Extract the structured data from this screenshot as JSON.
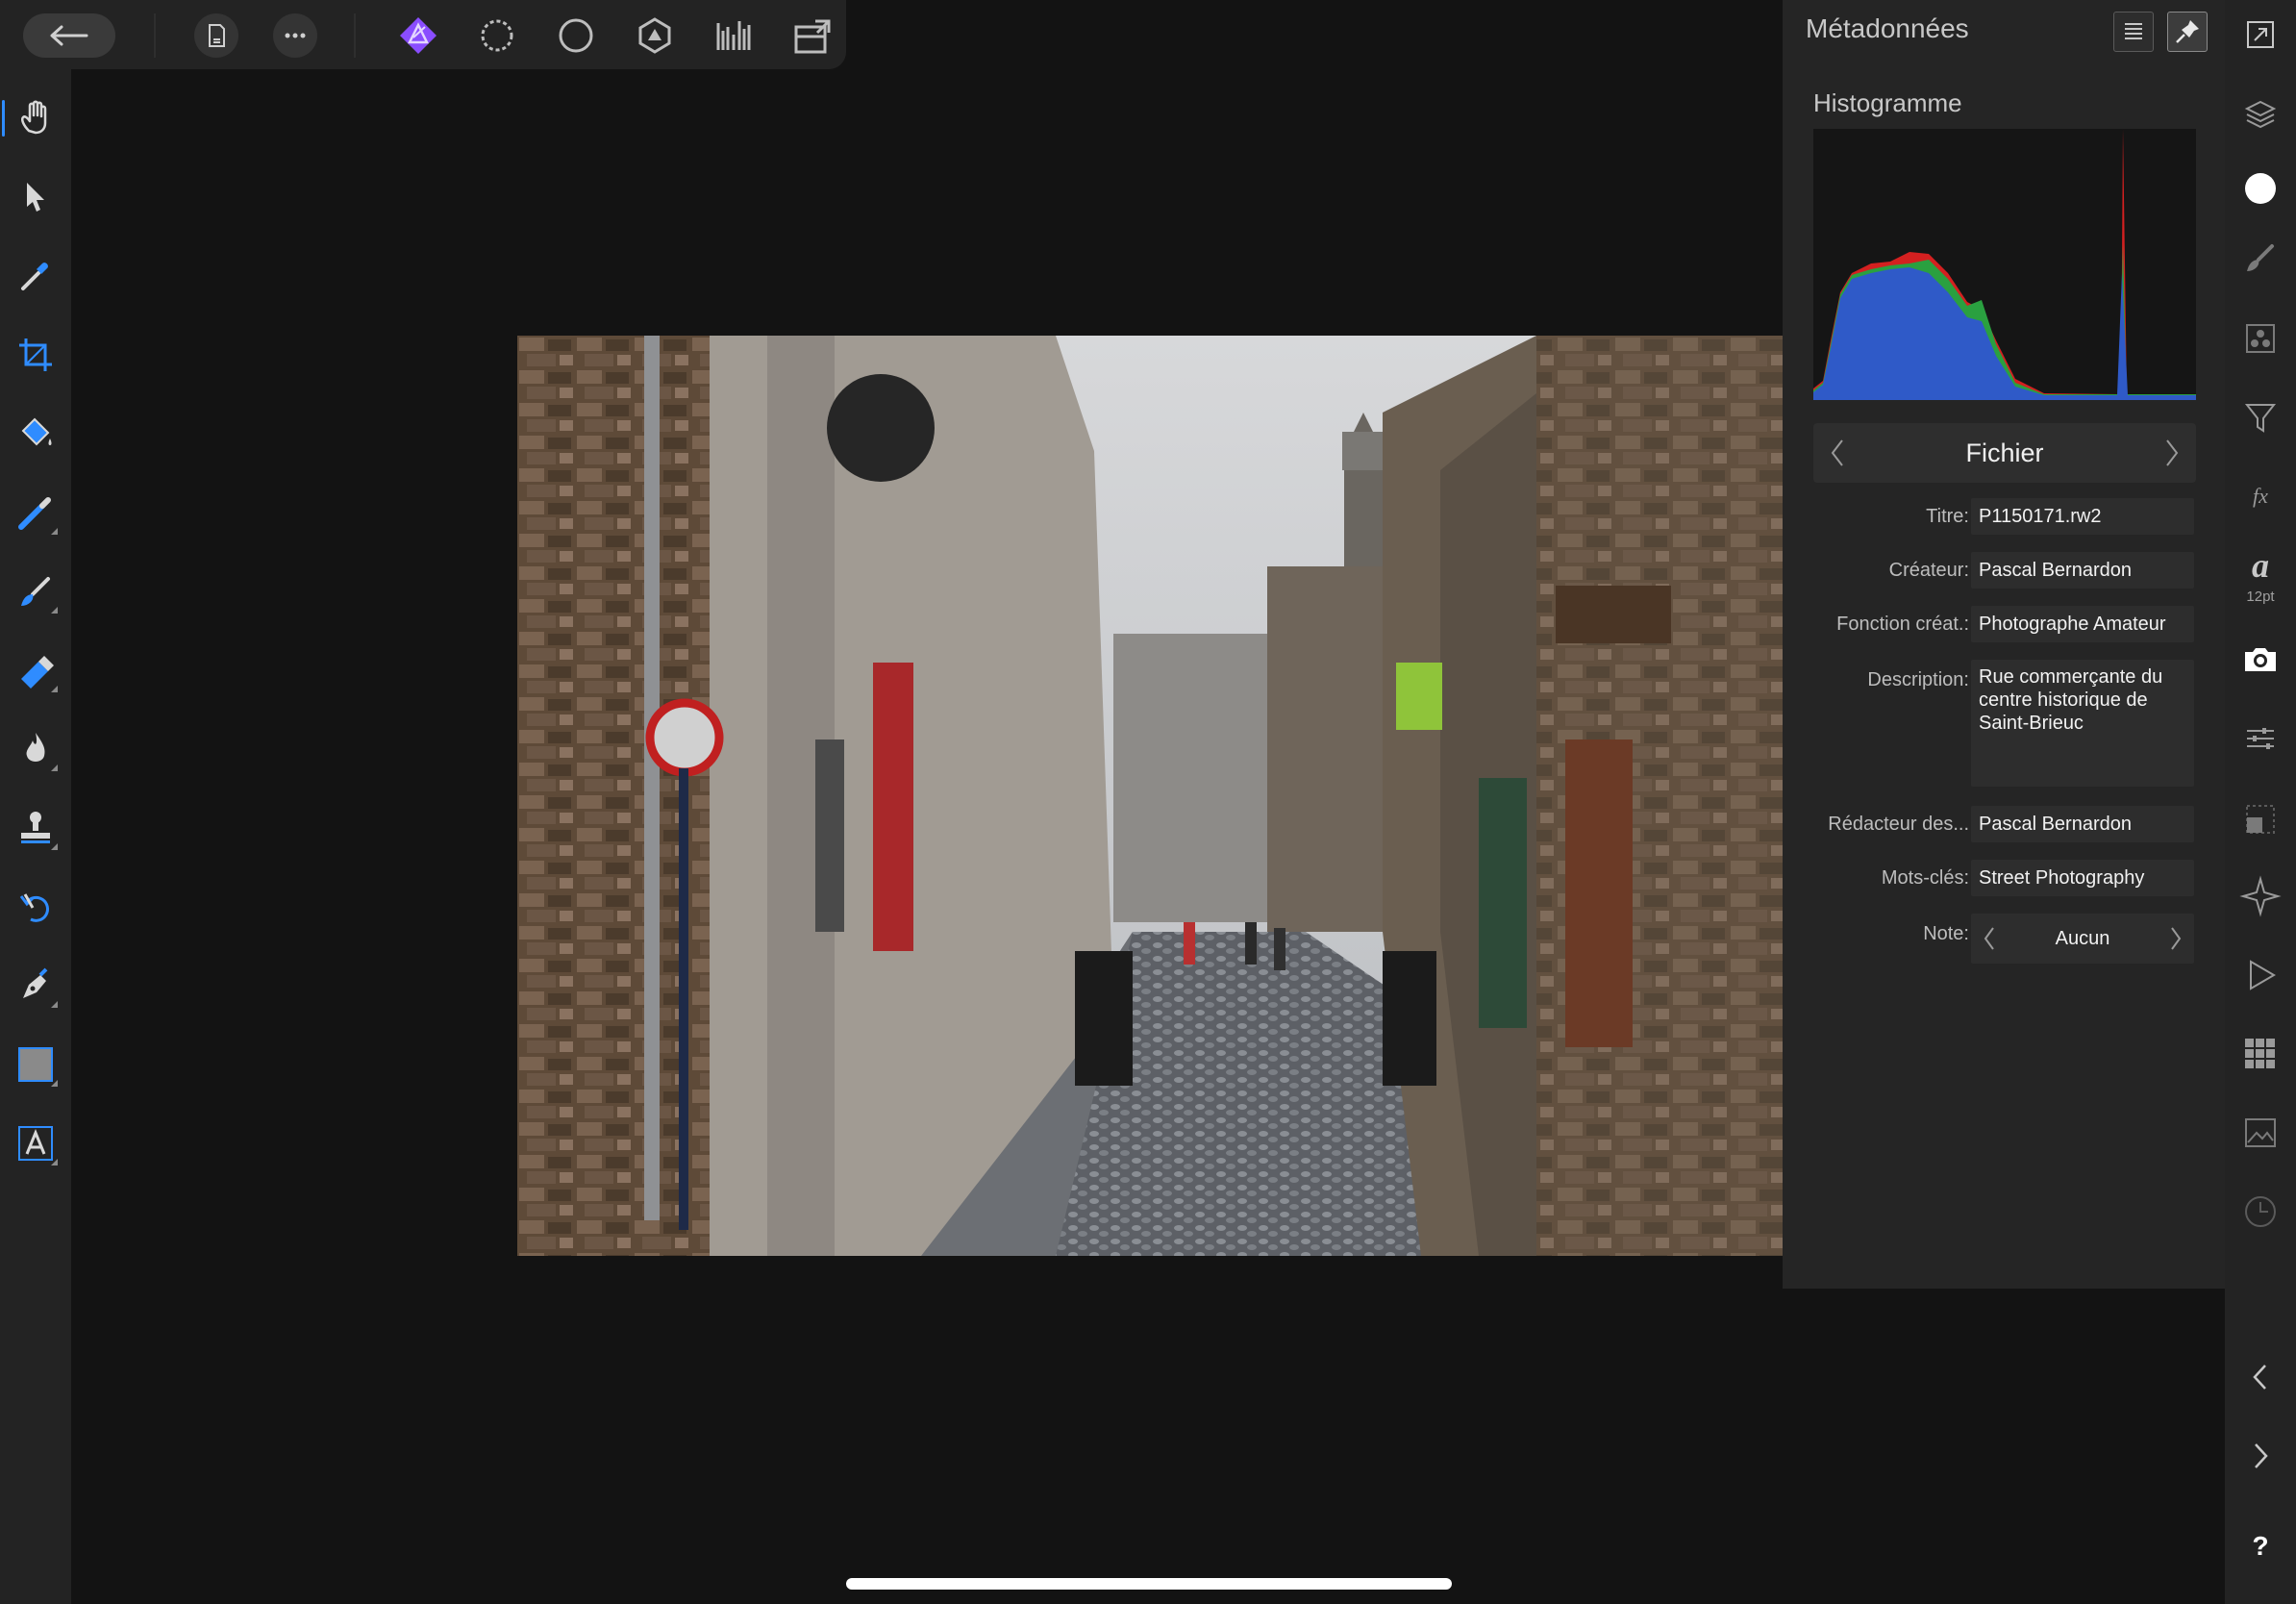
{
  "panel": {
    "title": "Métadonnées",
    "histogram_label": "Histogramme",
    "category": "Fichier",
    "fields": [
      {
        "label": "Titre:",
        "value": "P1150171.rw2"
      },
      {
        "label": "Créateur:",
        "value": "Pascal Bernardon"
      },
      {
        "label": "Fonction créat.:",
        "value": "Photographe Amateur"
      },
      {
        "label": "Description:",
        "value": "Rue commerçante du centre historique de Saint-Brieuc"
      },
      {
        "label": "Rédacteur des...",
        "value": "Pascal Bernardon"
      },
      {
        "label": "Mots-clés:",
        "value": "Street Photography"
      },
      {
        "label": "Note:",
        "value": "Aucun"
      }
    ]
  },
  "rail": {
    "font_size_label": "12pt",
    "help": "?"
  },
  "colors": {
    "accent_blue": "#2f8cff",
    "persona_purple": "#8a4dff",
    "panel_bg": "#252525",
    "toolbar_bg": "#232323"
  },
  "icons": {
    "top": [
      "back-arrow-icon",
      "document-icon",
      "more-icon",
      "photo-persona-icon",
      "liquify-persona-icon",
      "develop-persona-icon",
      "tone-mapping-persona-icon",
      "export-persona-icon",
      "view-mode-icon"
    ],
    "left": [
      "view-tool-icon",
      "move-tool-icon",
      "color-picker-icon",
      "crop-icon",
      "flood-fill-icon",
      "selection-brush-icon",
      "paint-brush-icon",
      "eraser-icon",
      "burn-icon",
      "clone-stamp-icon",
      "undo-brush-icon",
      "pen-icon",
      "rectangle-shape-icon",
      "text-tool-icon"
    ]
  }
}
